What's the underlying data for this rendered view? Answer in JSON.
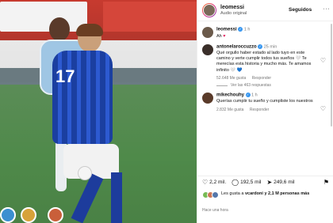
{
  "post": {
    "username": "leomessi",
    "audio": "Audio original",
    "follow_label": "Seguidos",
    "more_label": "···"
  },
  "caption": {
    "username": "leomessi",
    "time": "1 h",
    "text": "Ah"
  },
  "comments": [
    {
      "username": "antonelaroccuzzo",
      "time": "25 min",
      "text": "Qué orgullo haber estado al lado tuyo en este camino y verte cumplir todos tus sueños 🤍 Te merecías esta historia y mucho más. Te amamos infinito 🤍 💙",
      "likes": "52.648 Me gusta",
      "reply_label": "Responder",
      "replies": "Ver las 463 respuestas"
    },
    {
      "username": "mikechouhy",
      "time": "1 h",
      "text": "Querías cumplir tu sueño y cumpliste los nuestros",
      "likes": "2.832 Me gusta",
      "reply_label": "Responder"
    }
  ],
  "stats": {
    "likes": "2,2 mil.",
    "comments": "192,5 mil",
    "shares": "249,6 mil"
  },
  "liked_by": {
    "prefix": "Les gusta a",
    "user": "vcardoni",
    "suffix": "y 2,1 M personas más"
  },
  "posted_ago": "Hace una hora",
  "colors": {
    "accent": "#3897f0",
    "heart": "#e0245e"
  }
}
